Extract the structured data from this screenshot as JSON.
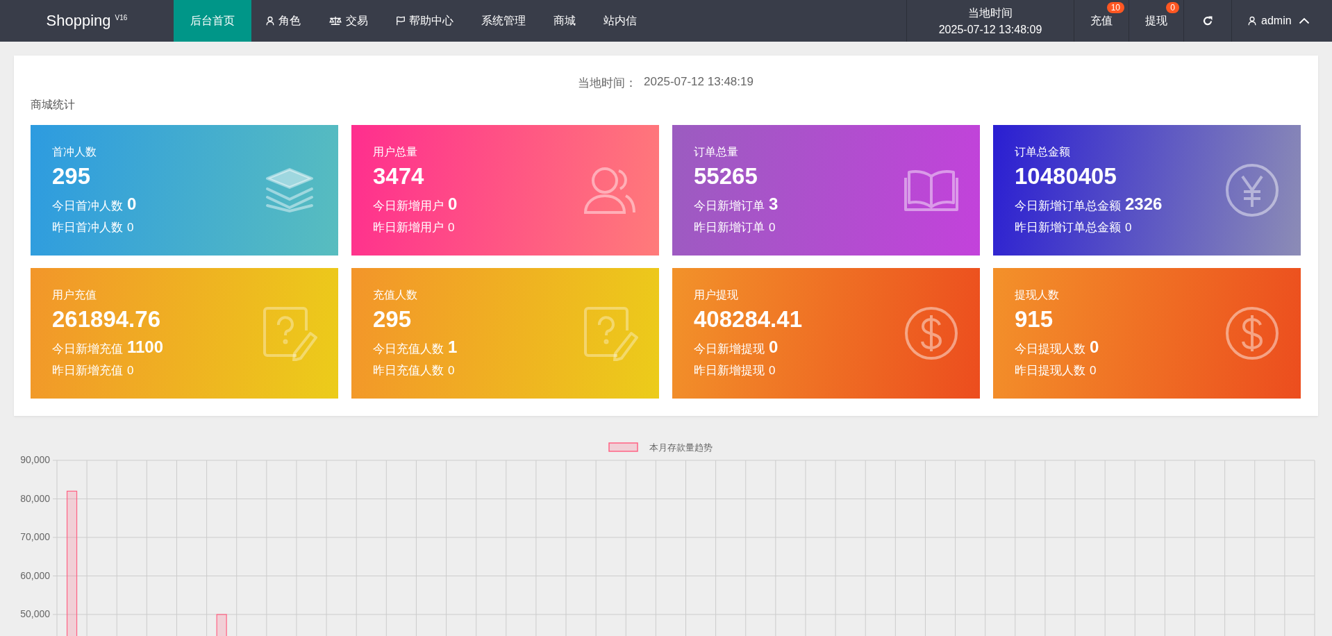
{
  "topbar": {
    "logo": "Shopping",
    "version": "V16",
    "nav": [
      {
        "label": "后台首页",
        "selected": true
      },
      {
        "label": "角色",
        "selected": false
      },
      {
        "label": "交易",
        "selected": false
      },
      {
        "label": "帮助中心",
        "selected": false
      },
      {
        "label": "系统管理",
        "selected": false
      },
      {
        "label": "商城",
        "selected": false
      },
      {
        "label": "站内信",
        "selected": false
      }
    ],
    "clock": {
      "label": "当地时间",
      "time": "2025-07-12 13:48:09"
    },
    "actions": [
      {
        "label": "充值",
        "badge": "10"
      },
      {
        "label": "提现",
        "badge": "0"
      }
    ],
    "user": "admin"
  },
  "stats": {
    "time_label": "当地时间：",
    "time": "2025-07-12 13:48:19",
    "title": "商城统计",
    "cards": [
      {
        "title": "首冲人数",
        "value": "295",
        "today_label": "今日首冲人数",
        "today_value": "0",
        "yesterday_label": "昨日首冲人数",
        "yesterday_value": "0",
        "color": "#2d9be0"
      },
      {
        "title": "用户总量",
        "value": "3474",
        "today_label": "今日新增用户",
        "today_value": "0",
        "yesterday_label": "昨日新增用户",
        "yesterday_value": "0",
        "color": "#ff2e8e"
      },
      {
        "title": "订单总量",
        "value": "55265",
        "today_label": "今日新增订单",
        "today_value": "3",
        "yesterday_label": "昨日新增订单",
        "yesterday_value": "0",
        "color": "#9b5cc0"
      },
      {
        "title": "订单总金额",
        "value": "10480405",
        "today_label": "今日新增订单总金额",
        "today_value": "2326",
        "yesterday_label": "昨日新增订单总金额",
        "yesterday_value": "0",
        "color": "#2a1ed2"
      },
      {
        "title": "用户充值",
        "value": "261894.76",
        "today_label": "今日新增充值",
        "today_value": "1100",
        "yesterday_label": "昨日新增充值",
        "yesterday_value": "0",
        "color": "#f2962a"
      },
      {
        "title": "充值人数",
        "value": "295",
        "today_label": "今日充值人数",
        "today_value": "1",
        "yesterday_label": "昨日充值人数",
        "yesterday_value": "0",
        "color": "#f3952a"
      },
      {
        "title": "用户提现",
        "value": "408284.41",
        "today_label": "今日新增提现",
        "today_value": "0",
        "yesterday_label": "昨日新增提现",
        "yesterday_value": "0",
        "color": "#f2922a"
      },
      {
        "title": "提现人数",
        "value": "915",
        "today_label": "今日提现人数",
        "today_value": "0",
        "yesterday_label": "昨日提现人数",
        "yesterday_value": "0",
        "color": "#f3912a"
      }
    ]
  },
  "chart": {
    "chart_data": {
      "type": "bar",
      "series": [
        {
          "name": "本月存款量趋势",
          "color": "#ff6384",
          "values": [
            82000,
            null,
            null,
            null,
            null,
            50000,
            null,
            null,
            null,
            null,
            null,
            null,
            null,
            null,
            null,
            null,
            null,
            null,
            null,
            null,
            null,
            null,
            null,
            null,
            null,
            null,
            null,
            null,
            null,
            null,
            null,
            null,
            null,
            null,
            null,
            null,
            null,
            null,
            null,
            null,
            null,
            null
          ]
        }
      ],
      "grid": true,
      "ylim": [
        0,
        90000
      ],
      "yticks": [
        {
          "value": 50000,
          "label": "50,000"
        },
        {
          "value": 60000,
          "label": "60,000"
        },
        {
          "value": 70000,
          "label": "70,000"
        },
        {
          "value": 80000,
          "label": "80,000"
        },
        {
          "value": 90000,
          "label": "90,000"
        }
      ]
    }
  }
}
